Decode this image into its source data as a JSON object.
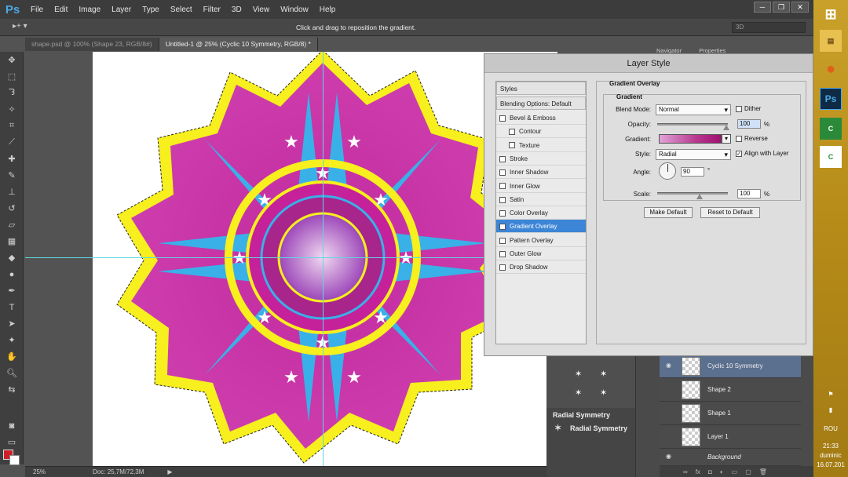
{
  "app": {
    "logo": "Ps"
  },
  "menu": [
    "File",
    "Edit",
    "Image",
    "Layer",
    "Type",
    "Select",
    "Filter",
    "3D",
    "View",
    "Window",
    "Help"
  ],
  "options_bar": {
    "hint": "Click and drag to reposition the gradient.",
    "workspace": "3D"
  },
  "doc_tabs": [
    {
      "label": "shape.psd @ 100% (Shape 23, RGB/8#)"
    },
    {
      "label": "Untitled-1 @ 25% (Cyclic 10 Symmetry, RGB/8) *"
    }
  ],
  "status": {
    "zoom": "25%",
    "doc": "Doc: 25,7M/72,3M"
  },
  "panel_tabs": {
    "navigator": "Navigator",
    "properties": "Properties"
  },
  "dialog": {
    "title": "Layer Style",
    "styles_header": "Styles",
    "blending": "Blending Options: Default",
    "items": [
      {
        "label": "Bevel & Emboss",
        "checked": false,
        "sub": false
      },
      {
        "label": "Contour",
        "checked": false,
        "sub": true
      },
      {
        "label": "Texture",
        "checked": false,
        "sub": true
      },
      {
        "label": "Stroke",
        "checked": false,
        "sub": false
      },
      {
        "label": "Inner Shadow",
        "checked": false,
        "sub": false
      },
      {
        "label": "Inner Glow",
        "checked": false,
        "sub": false
      },
      {
        "label": "Satin",
        "checked": false,
        "sub": false
      },
      {
        "label": "Color Overlay",
        "checked": false,
        "sub": false
      },
      {
        "label": "Gradient Overlay",
        "checked": true,
        "sub": false,
        "selected": true
      },
      {
        "label": "Pattern Overlay",
        "checked": false,
        "sub": false
      },
      {
        "label": "Outer Glow",
        "checked": false,
        "sub": false
      },
      {
        "label": "Drop Shadow",
        "checked": false,
        "sub": false
      }
    ],
    "section_title": "Gradient Overlay",
    "group_title": "Gradient",
    "blend_mode_label": "Blend Mode:",
    "blend_mode": "Normal",
    "dither_label": "Dither",
    "opacity_label": "Opacity:",
    "opacity": "100",
    "percent": "%",
    "gradient_label": "Gradient:",
    "reverse_label": "Reverse",
    "style_label": "Style:",
    "style": "Radial",
    "align_label": "Align with Layer",
    "angle_label": "Angle:",
    "angle": "90",
    "degree": "°",
    "scale_label": "Scale:",
    "scale": "100",
    "make_default": "Make Default",
    "reset_default": "Reset to Default"
  },
  "actions": {
    "title": "Radial Symmetry",
    "row": "Radial Symmetry"
  },
  "layers": [
    {
      "name": "Cyclic 10 Symmetry",
      "selected": true
    },
    {
      "name": "Shape 2",
      "selected": false
    },
    {
      "name": "Shape 1",
      "selected": false
    },
    {
      "name": "Layer 1",
      "selected": false
    },
    {
      "name": "Background",
      "selected": false
    }
  ],
  "taskbar": {
    "lang": "ROU",
    "time": "21:33",
    "day": "duminic",
    "date": "16.07.201"
  },
  "colors": {
    "magenta": "#c2249a",
    "cyan": "#3ab0e8",
    "yellow": "#f7ef1e",
    "accent": "#3d85d6"
  }
}
